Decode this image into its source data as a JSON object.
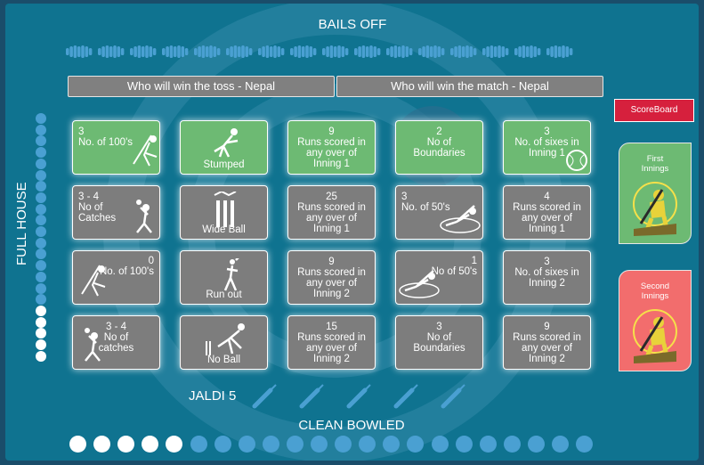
{
  "header": {
    "title": "BAILS OFF"
  },
  "banners": {
    "toss": "Who will win the toss - Nepal",
    "match": "Who will win the match - Nepal"
  },
  "full_house": {
    "label": "FULL HOUSE"
  },
  "jaldi": {
    "label": "JALDI 5"
  },
  "clean_bowled": {
    "label": "CLEAN BOWLED"
  },
  "side": {
    "scoreboard": "ScoreBoard",
    "first_innings": "First\nInnings",
    "second_innings": "Second\nInnings"
  },
  "colors": {
    "frame": "#0f7390",
    "green_cell": "#6dba73",
    "grey_cell": "#7d7d7d",
    "scoreboard": "#d6203d",
    "first_innings": "#6dba73",
    "second_innings": "#f26d6d",
    "accent_blue": "#4aa0d2"
  },
  "grid": [
    [
      {
        "text": "3\nNo. of 100's",
        "state": "green",
        "align": "left",
        "icon": "batsman-icon"
      },
      {
        "text": "Stumped",
        "state": "green",
        "align": "bottom",
        "icon": "fielder-dive-icon"
      },
      {
        "text": "9\nRuns scored in\nany over of\nInning 1",
        "state": "green",
        "align": "center",
        "icon": ""
      },
      {
        "text": "2\nNo of\nBoundaries",
        "state": "green",
        "align": "center",
        "icon": ""
      },
      {
        "text": "3\nNo. of sixes in\nInning 1",
        "state": "green",
        "align": "center",
        "icon": "cricket-ball-icon"
      }
    ],
    [
      {
        "text": "3 - 4\nNo of\nCatches",
        "state": "grey",
        "align": "left",
        "icon": "catch-icon"
      },
      {
        "text": "Wide Ball",
        "state": "grey",
        "align": "bottom",
        "icon": "stumps-icon"
      },
      {
        "text": "25\nRuns scored in\nany over of\nInning 1",
        "state": "grey",
        "align": "center",
        "icon": ""
      },
      {
        "text": "3\nNo. of 50's",
        "state": "grey",
        "align": "left",
        "icon": "sliding-batsman-icon"
      },
      {
        "text": "4\nRuns scored in\nany over of\nInning 1",
        "state": "grey",
        "align": "center",
        "icon": ""
      }
    ],
    [
      {
        "text": "0\nNo. of 100's",
        "state": "grey",
        "align": "right",
        "icon": "batsman-icon"
      },
      {
        "text": "Run out",
        "state": "grey",
        "align": "bottom",
        "icon": "runner-icon"
      },
      {
        "text": "9\nRuns scored in\nany over of\nInning 2",
        "state": "grey",
        "align": "center",
        "icon": ""
      },
      {
        "text": "1\nNo of 50's",
        "state": "grey",
        "align": "right",
        "icon": "sliding-batsman-icon"
      },
      {
        "text": "3\nNo. of sixes in\nInning 2",
        "state": "grey",
        "align": "center",
        "icon": ""
      }
    ],
    [
      {
        "text": "3 - 4\nNo of\ncatches",
        "state": "grey",
        "align": "center",
        "icon": "catch-icon"
      },
      {
        "text": "No Ball",
        "state": "grey",
        "align": "bottom",
        "icon": "bowler-icon"
      },
      {
        "text": "15\nRuns scored in\nany over of\nInning 2",
        "state": "grey",
        "align": "center",
        "icon": ""
      },
      {
        "text": "3\nNo of\nBoundaries",
        "state": "grey",
        "align": "center",
        "icon": ""
      },
      {
        "text": "9\nRuns scored in\nany over of\nInning 2",
        "state": "grey",
        "align": "center",
        "icon": ""
      }
    ]
  ],
  "full_house_track": {
    "total": 22,
    "filled": 5
  },
  "clean_bowled_track": {
    "total": 22,
    "filled": 5
  },
  "jaldi_track": {
    "total": 5,
    "filled": 0
  }
}
